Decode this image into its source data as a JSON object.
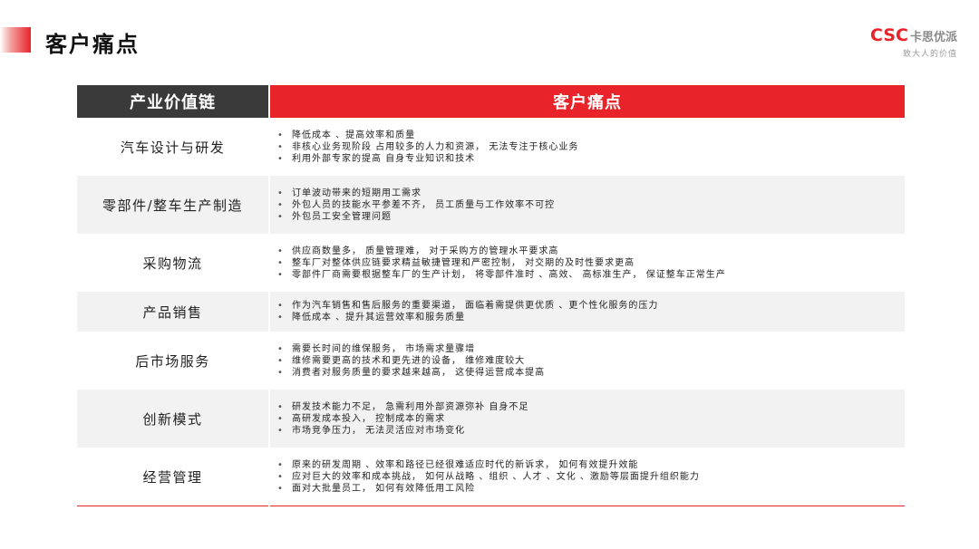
{
  "header": {
    "title": "客户痛点"
  },
  "logo": {
    "brand": "CSC",
    "name_cn": "卡思优派",
    "slogan": "致大人的价值"
  },
  "colors": {
    "accent": "#e8232a",
    "header_dark": "#3a3a3a",
    "row_shade": "#f2f2f2"
  },
  "table": {
    "col1_header": "产业价值链",
    "col2_header": "客户痛点",
    "rows": [
      {
        "label": "汽车设计与研发",
        "points": [
          "降低成本 、提高效率和质量",
          "非核心业务现阶段 占用较多的人力和资源， 无法专注于核心业务",
          "利用外部专家的提高 自身专业知识和技术"
        ]
      },
      {
        "label": "零部件/整车生产制造",
        "points": [
          "订单波动带来的短期用工需求",
          "外包人员的技能水平参差不齐， 员工质量与工作效率不可控",
          "外包员工安全管理问题"
        ]
      },
      {
        "label": "采购物流",
        "points": [
          "供应商数量多， 质量管理难， 对于采购方的管理水平要求高",
          "整车厂对整体供应链要求精益敏捷管理和严密控制， 对交期的及时性要求更高",
          "零部件厂商需要根据整车厂的生产计划， 将零部件准时 、高效、 高标准生产， 保证整车正常生产"
        ]
      },
      {
        "label": "产品销售",
        "points": [
          "作为汽车销售和售后服务的重要渠道， 面临着需提供更优质 、更个性化服务的压力",
          "降低成本 、提升其运营效率和服务质量"
        ]
      },
      {
        "label": "后市场服务",
        "points": [
          "需要长时间的维保服务， 市场需求量骤增",
          "维修需要更高的技术和更先进的设备， 维修难度较大",
          "消费者对服务质量的要求越来越高， 这使得运营成本提高"
        ]
      },
      {
        "label": "创新模式",
        "points": [
          "研发技术能力不足， 急需利用外部资源弥补 自身不足",
          "高研发成本投入， 控制成本的需求",
          "市场竞争压力， 无法灵活应对市场变化"
        ]
      },
      {
        "label": "经营管理",
        "points": [
          "原来的研发周期 、效率和路径已经很难适应时代的新诉求， 如何有效提升效能",
          "应对巨大的效率和成本挑战， 如何从战略 、组织 、人才 、文化 、激励等层面提升组织能力",
          "面对大批量员工， 如何有效降低用工风险"
        ]
      }
    ]
  }
}
